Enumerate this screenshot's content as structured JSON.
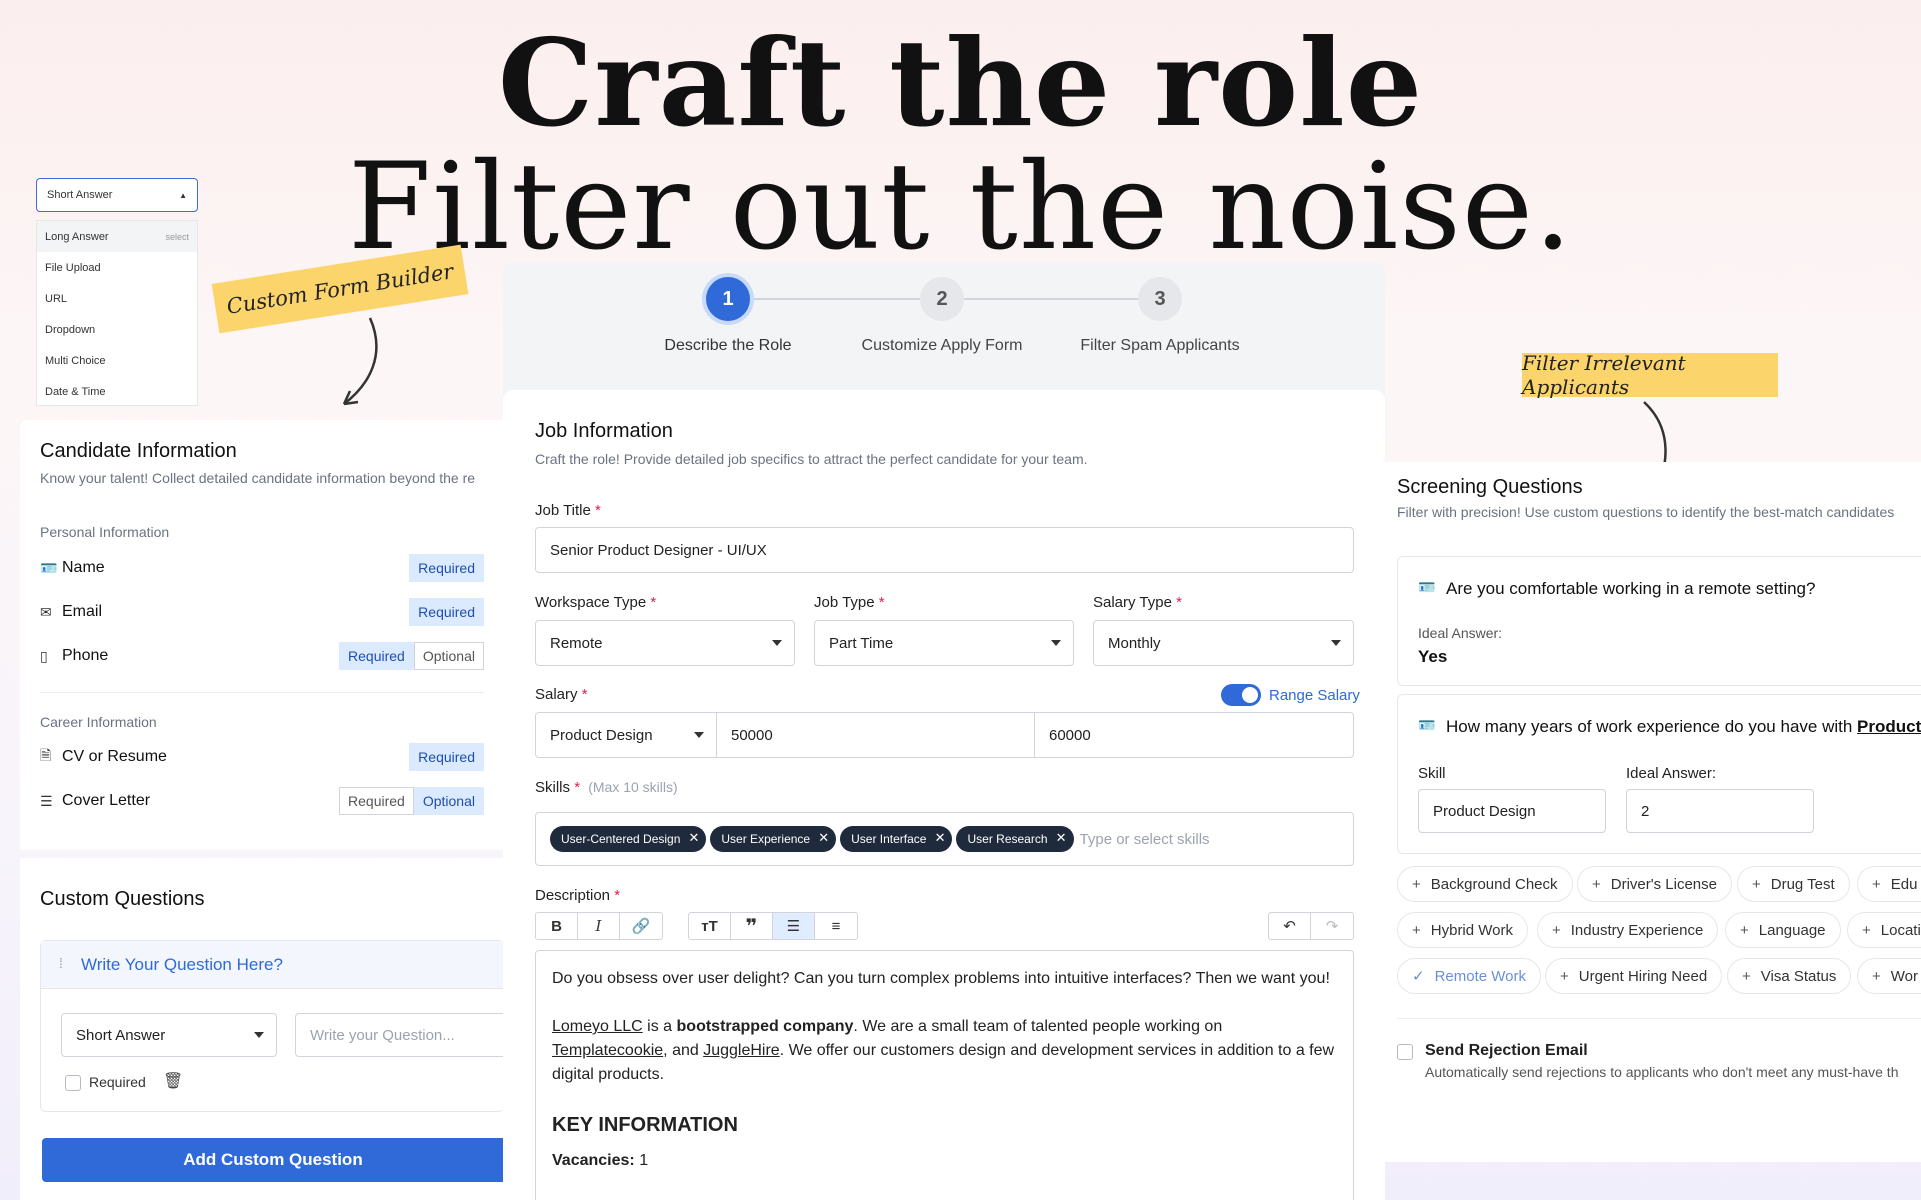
{
  "headline": {
    "line1": "Craft the role",
    "line2": "Filter out the noise."
  },
  "callouts": {
    "form_builder": "Custom Form Builder",
    "filter": "Filter Irrelevant Applicants"
  },
  "answer_type_dropdown": {
    "selected": "Short Answer",
    "select_hint": "select",
    "options": [
      "Long Answer",
      "File Upload",
      "URL",
      "Dropdown",
      "Multi Choice",
      "Date & Time"
    ]
  },
  "candidate_info": {
    "title": "Candidate Information",
    "subtitle": "Know your talent! Collect detailed candidate information beyond the re",
    "personal_label": "Personal Information",
    "career_label": "Career Information",
    "required_label": "Required",
    "optional_label": "Optional",
    "fields": {
      "name": "Name",
      "email": "Email",
      "phone": "Phone",
      "cv": "CV or Resume",
      "cover": "Cover Letter"
    }
  },
  "custom_questions": {
    "title": "Custom Questions",
    "question_placeholder_title": "Write Your Question Here?",
    "type_value": "Short Answer",
    "question_input_placeholder": "Write your Question...",
    "required_label": "Required",
    "add_button": "Add Custom Question"
  },
  "steps": [
    {
      "num": "1",
      "label": "Describe the Role"
    },
    {
      "num": "2",
      "label": "Customize Apply Form"
    },
    {
      "num": "3",
      "label": "Filter Spam Applicants"
    }
  ],
  "job_form": {
    "title": "Job Information",
    "subtitle": "Craft the role! Provide detailed job specifics to attract the perfect candidate for your team.",
    "job_title_label": "Job Title",
    "job_title_value": "Senior Product Designer - UI/UX",
    "workspace_label": "Workspace Type",
    "workspace_value": "Remote",
    "job_type_label": "Job Type",
    "job_type_value": "Part Time",
    "salary_type_label": "Salary Type",
    "salary_type_value": "Monthly",
    "salary_label": "Salary",
    "range_label": "Range Salary",
    "range_on": true,
    "salary_category": "Product Design",
    "salary_min": "50000",
    "salary_max": "60000",
    "skills_label": "Skills",
    "skills_hint": "(Max 10 skills)",
    "skills": [
      "User-Centered Design",
      "User Experience",
      "User Interface",
      "User Research"
    ],
    "skills_placeholder": "Type or select skills",
    "description_label": "Description",
    "description": {
      "p1": "Do you obsess over user delight? Can you turn complex problems into intuitive interfaces? Then we want you!",
      "company": "Lomeyo LLC",
      "is_a": " is a ",
      "bold1": "bootstrapped company",
      "rest1": ". We are a small team of talented people working on ",
      "link2": "Templatecookie",
      "and": ", and ",
      "link3": "JuggleHire",
      "rest2": ". We offer our customers design and development services in addition to a few digital products.",
      "heading": "KEY INFORMATION",
      "vacancies_label": "Vacancies:",
      "vacancies_value": "1"
    }
  },
  "screening": {
    "title": "Screening Questions",
    "subtitle": "Filter with precision! Use custom questions to identify the best-match candidates",
    "q1": "Are you comfortable working in a remote setting?",
    "ideal_label": "Ideal Answer:",
    "q1_answer": "Yes",
    "q2": "How many years of work experience do you have with ",
    "q2_bold": "Product I",
    "skill_label": "Skill",
    "skill_value": "Product Design",
    "ideal_value": "2",
    "tags_row1": [
      "Background Check",
      "Driver's License",
      "Drug Test",
      "Edu"
    ],
    "tags_row2": [
      "Hybrid Work",
      "Industry Experience",
      "Language",
      "Locati"
    ],
    "tags_row3": [
      "Remote Work",
      "Urgent Hiring Need",
      "Visa Status",
      "Wor"
    ],
    "rejection_title": "Send Rejection Email",
    "rejection_sub": "Automatically send rejections to applicants who don't meet any must-have th"
  },
  "colors": {
    "accent": "#2f6ad8",
    "chip": "#1f2a3c",
    "note": "#fbd56b"
  }
}
